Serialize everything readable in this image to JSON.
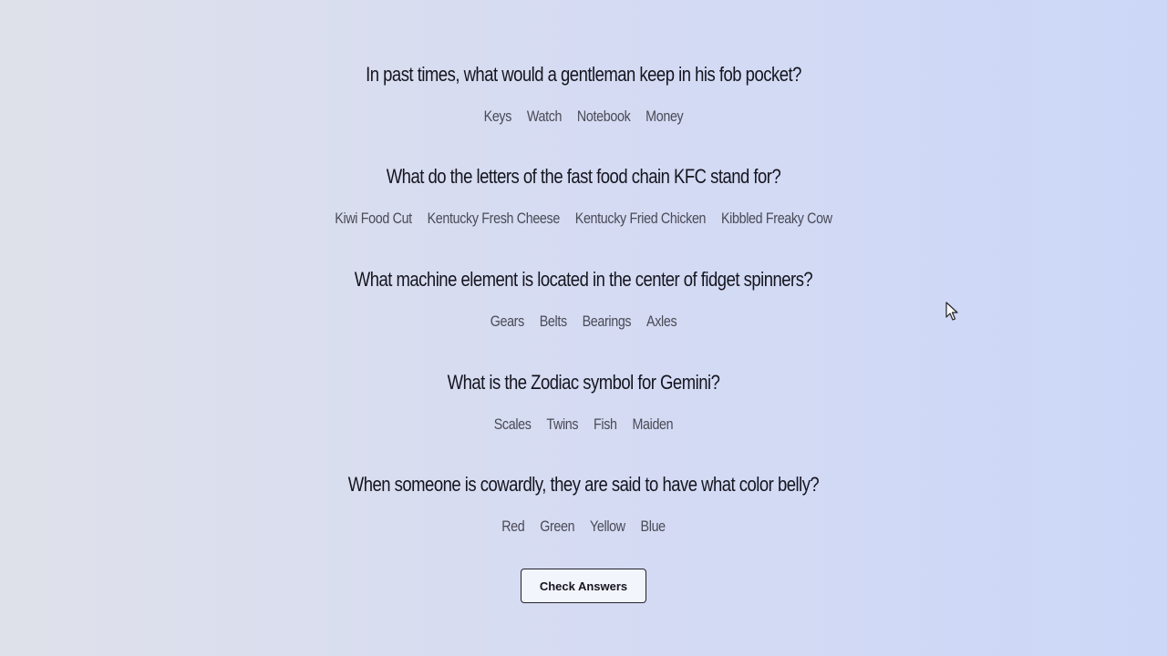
{
  "questions": [
    {
      "text": "In past times, what would a gentleman keep in his fob pocket?",
      "answers": [
        "Keys",
        "Watch",
        "Notebook",
        "Money"
      ]
    },
    {
      "text": "What do the letters of the fast food chain KFC stand for?",
      "answers": [
        "Kiwi Food Cut",
        "Kentucky Fresh Cheese",
        "Kentucky Fried Chicken",
        "Kibbled Freaky Cow"
      ]
    },
    {
      "text": "What machine element is located in the center of fidget spinners?",
      "answers": [
        "Gears",
        "Belts",
        "Bearings",
        "Axles"
      ]
    },
    {
      "text": "What is the Zodiac symbol for Gemini?",
      "answers": [
        "Scales",
        "Twins",
        "Fish",
        "Maiden"
      ]
    },
    {
      "text": "When someone is cowardly, they are said to have what color belly?",
      "answers": [
        "Red",
        "Green",
        "Yellow",
        "Blue"
      ]
    }
  ],
  "check_button": {
    "label": "Check Answers"
  },
  "cursor": {
    "icon": "mouse-pointer-icon"
  }
}
